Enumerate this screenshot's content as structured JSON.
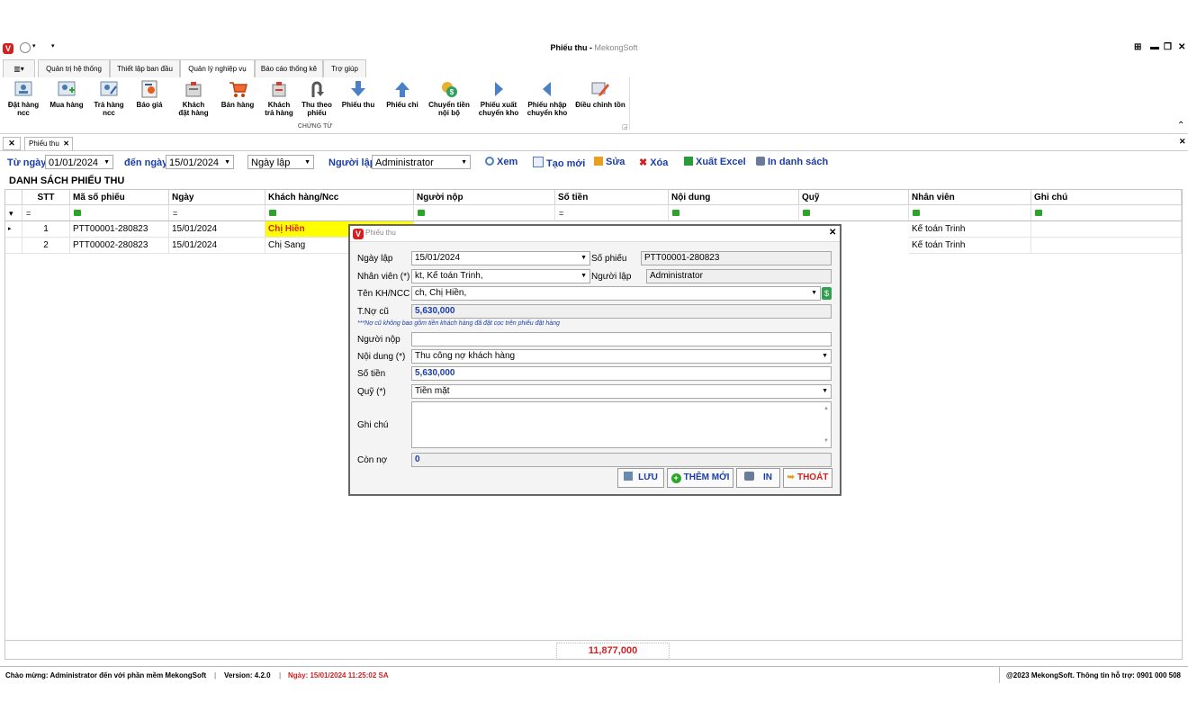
{
  "window": {
    "title": "Phiếu thu",
    "brand": "MekongSoft"
  },
  "menu_tabs": [
    "Quản trị hệ thống",
    "Thiết lập ban đầu",
    "Quản lý nghiệp vụ",
    "Báo cáo thống kê",
    "Trợ giúp"
  ],
  "ribbon": {
    "buttons": [
      {
        "l1": "Đặt hàng",
        "l2": "ncc"
      },
      {
        "l1": "Mua hàng",
        "l2": ""
      },
      {
        "l1": "Trả hàng",
        "l2": "ncc"
      },
      {
        "l1": "Báo giá",
        "l2": ""
      },
      {
        "l1": "Khách",
        "l2": "đặt hàng"
      },
      {
        "l1": "Bán hàng",
        "l2": ""
      },
      {
        "l1": "Khách",
        "l2": "trả hàng"
      },
      {
        "l1": "Thu theo",
        "l2": "phiếu"
      },
      {
        "l1": "Phiếu thu",
        "l2": ""
      },
      {
        "l1": "Phiếu chi",
        "l2": ""
      },
      {
        "l1": "Chuyển tiền",
        "l2": "nội bộ"
      },
      {
        "l1": "Phiếu xuất",
        "l2": "chuyển kho"
      },
      {
        "l1": "Phiếu nhập",
        "l2": "chuyển kho"
      },
      {
        "l1": "Điều chỉnh tồn",
        "l2": ""
      }
    ],
    "group_label": "CHỨNG TỪ"
  },
  "doc_tab": "Phiếu thu",
  "filter": {
    "from_label": "Từ ngày",
    "from_value": "01/01/2024",
    "to_label": "đến ngày",
    "to_value": "15/01/2024",
    "date_type": "Ngày lập",
    "creator_label": "Người lập",
    "creator_value": "Administrator",
    "btn_view": "Xem",
    "btn_new": "Tạo mới",
    "btn_edit": "Sửa",
    "btn_delete": "Xóa",
    "btn_excel": "Xuất Excel",
    "btn_print": "In danh sách"
  },
  "list": {
    "title": "DANH SÁCH PHIẾU THU",
    "columns": [
      "STT",
      "Mã số phiếu",
      "Ngày",
      "Khách hàng/Ncc",
      "Người nộp",
      "Số tiền",
      "Nội dung",
      "Quỹ",
      "Nhân viên",
      "Ghi chú"
    ],
    "filter_ops": [
      "=",
      "=",
      "",
      "",
      "=",
      "",
      "",
      "",
      ""
    ],
    "rows": [
      {
        "stt": "1",
        "code": "PTT00001-280823",
        "date": "15/01/2024",
        "customer": "Chị Hiền",
        "staff": "Kế toán Trinh"
      },
      {
        "stt": "2",
        "code": "PTT00002-280823",
        "date": "15/01/2024",
        "customer": "Chị Sang",
        "staff": "Kế toán Trinh"
      }
    ],
    "total": "11,877,000"
  },
  "status": {
    "welcome": "Chào mừng: Administrator đến với phần mềm MekongSoft",
    "version": "Version: 4.2.0",
    "date": "Ngày: 15/01/2024 11:25:02 SA",
    "copyright": "@2023 MekongSoft. Thông tin hỗ trợ: 0901 000 508"
  },
  "dialog": {
    "title": "Phiếu thu",
    "date_label": "Ngày lập",
    "date_value": "15/01/2024",
    "no_label": "Số phiếu",
    "no_value": "PTT00001-280823",
    "staff_label": "Nhân viên (*)",
    "staff_value": "kt, Kế toán Trinh,",
    "creator_label": "Người lập",
    "creator_value": "Administrator",
    "cust_label": "Tên KH/NCC",
    "cust_value": "ch, Chị Hiền,",
    "debt_label": "T.Nợ cũ",
    "debt_value": "5,630,000",
    "note": "***Nợ cũ  không bao gồm tiền khách hàng đã đặt cọc trên phiếu đặt hàng",
    "payer_label": "Người nộp",
    "payer_value": "",
    "content_label": "Nội dung (*)",
    "content_value": "Thu công nợ khách hàng",
    "amount_label": "Số tiền",
    "amount_value": "5,630,000",
    "fund_label": "Quỹ (*)",
    "fund_value": "Tiền mặt",
    "memo_label": "Ghi chú",
    "memo_value": "",
    "remain_label": "Còn nợ",
    "remain_value": "0",
    "btn_save": "LƯU",
    "btn_add": "THÊM MỚI",
    "btn_print": "IN",
    "btn_exit": "THOÁT"
  },
  "colors": {
    "accent": "#1a3ea8",
    "highlight": "#ffff00",
    "danger": "#d32020",
    "total": "#d32020"
  }
}
